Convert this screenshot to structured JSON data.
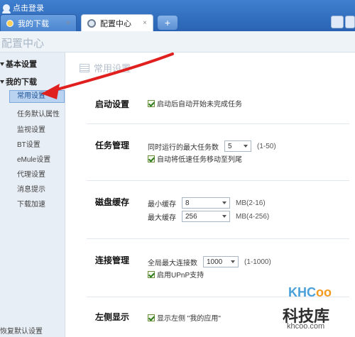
{
  "titlebar": {
    "login_label": "点击登录"
  },
  "tabs": [
    {
      "label": "我的下载",
      "active": false
    },
    {
      "label": "配置中心",
      "active": true
    }
  ],
  "header": {
    "title": "配置中心"
  },
  "sidebar": {
    "groups": [
      {
        "label": "基本设置"
      },
      {
        "label": "我的下载"
      }
    ],
    "items": [
      {
        "label": "常用设置",
        "active": true
      },
      {
        "label": "任务默认属性"
      },
      {
        "label": "监视设置"
      },
      {
        "label": "BT设置"
      },
      {
        "label": "eMule设置"
      },
      {
        "label": "代理设置"
      },
      {
        "label": "消息提示"
      },
      {
        "label": "下载加速"
      }
    ],
    "restore_label": "恢复默认设置"
  },
  "main": {
    "section_title": "常用设置",
    "startup": {
      "label": "启动设置",
      "option": "启动后自动开始未完成任务",
      "checked": true
    },
    "task": {
      "label": "任务管理",
      "max_tasks_label": "同时运行的最大任务数",
      "max_tasks_value": "5",
      "max_tasks_range": "(1-50)",
      "auto_move_option": "自动将低速任务移动至列尾",
      "checked": true
    },
    "disk": {
      "label": "磁盘缓存",
      "min_label": "最小缓存",
      "min_value": "8",
      "min_range": "MB(2-16)",
      "max_label": "最大缓存",
      "max_value": "256",
      "max_range": "MB(4-256)"
    },
    "connection": {
      "label": "连接管理",
      "global_label": "全局最大连接数",
      "global_value": "1000",
      "global_range": "(1-1000)",
      "upnp_option": "启用UPnP支持",
      "checked": true
    },
    "left_display": {
      "label": "左侧显示",
      "option": "显示左侧 \"我的应用\"",
      "checked": true
    }
  },
  "watermark": {
    "brand_left": "KHC",
    "brand_right": "oo",
    "cn": "科技库",
    "url": "khcoo.com"
  },
  "colors": {
    "topbar": "#2a63b3",
    "sidebar_bg": "#e8eef5",
    "annotation_arrow": "#e0201e"
  }
}
